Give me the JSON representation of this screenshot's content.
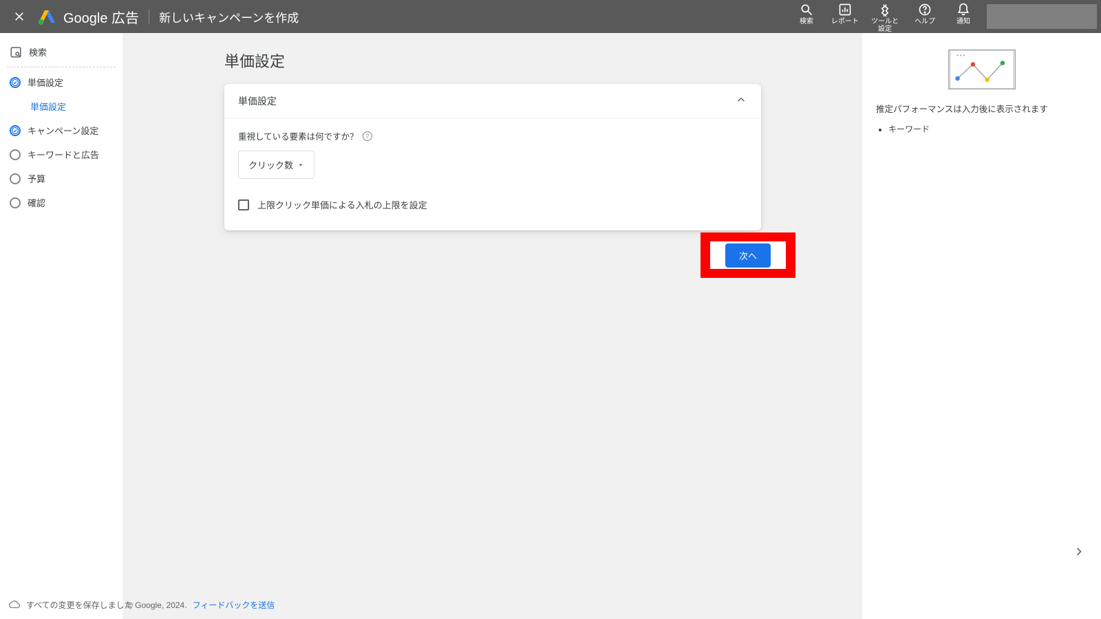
{
  "header": {
    "brand": "Google 広告",
    "title": "新しいキャンペーンを作成",
    "tools": {
      "search": "検索",
      "reports": "レポート",
      "tools_settings": "ツールと\n設定",
      "help": "ヘルプ",
      "notifications": "通知"
    }
  },
  "sidebar": {
    "campaign_type": "検索",
    "steps": {
      "bidding": "単価設定",
      "bidding_sub": "単価設定",
      "campaign_settings": "キャンペーン設定",
      "keywords_ads": "キーワードと広告",
      "budget": "予算",
      "review": "確認"
    }
  },
  "main": {
    "page_title": "単価設定",
    "card_title": "単価設定",
    "question": "重視している要素は何ですか？",
    "select_value": "クリック数",
    "checkbox_label": "上限クリック単価による入札の上限を設定",
    "next_button": "次へ"
  },
  "perf": {
    "message": "推定パフォーマンスは入力後に表示されます",
    "bullets": [
      "キーワード"
    ]
  },
  "footer": {
    "saved": "すべての変更を保存しました",
    "copyright": "© Google, 2024.",
    "feedback": "フィードバックを送信"
  }
}
